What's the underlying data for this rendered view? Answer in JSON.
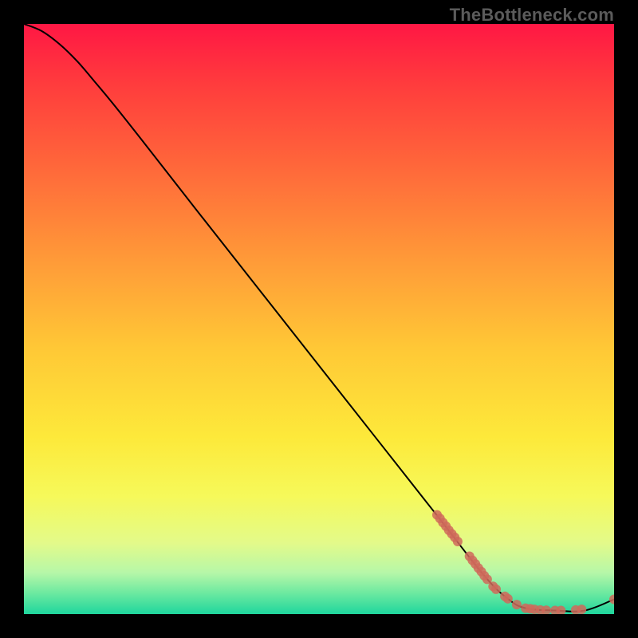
{
  "watermark": "TheBottleneck.com",
  "chart_data": {
    "type": "line",
    "title": "",
    "xlabel": "",
    "ylabel": "",
    "xlim": [
      0,
      100
    ],
    "ylim": [
      0,
      100
    ],
    "grid": false,
    "legend": false,
    "curve_color": "#000000",
    "marker_color": "#cf6a5b",
    "background_gradient": {
      "stops": [
        {
          "pos": 0.0,
          "color": "#ff1744"
        },
        {
          "pos": 0.1,
          "color": "#ff3b3d"
        },
        {
          "pos": 0.25,
          "color": "#ff6a3a"
        },
        {
          "pos": 0.4,
          "color": "#ff9a38"
        },
        {
          "pos": 0.55,
          "color": "#ffc836"
        },
        {
          "pos": 0.7,
          "color": "#fde93a"
        },
        {
          "pos": 0.8,
          "color": "#f6f95a"
        },
        {
          "pos": 0.88,
          "color": "#e3fa8a"
        },
        {
          "pos": 0.93,
          "color": "#b6f7a8"
        },
        {
          "pos": 0.965,
          "color": "#6be9a0"
        },
        {
          "pos": 1.0,
          "color": "#1fd69d"
        }
      ]
    },
    "curve": [
      {
        "x": 0.0,
        "y": 100.0
      },
      {
        "x": 3.0,
        "y": 98.8
      },
      {
        "x": 6.0,
        "y": 96.6
      },
      {
        "x": 9.0,
        "y": 93.7
      },
      {
        "x": 12.0,
        "y": 90.2
      },
      {
        "x": 15.0,
        "y": 86.6
      },
      {
        "x": 20.0,
        "y": 80.3
      },
      {
        "x": 30.0,
        "y": 67.5
      },
      {
        "x": 40.0,
        "y": 54.8
      },
      {
        "x": 50.0,
        "y": 42.1
      },
      {
        "x": 60.0,
        "y": 29.4
      },
      {
        "x": 70.0,
        "y": 16.7
      },
      {
        "x": 78.0,
        "y": 6.5
      },
      {
        "x": 82.0,
        "y": 2.6
      },
      {
        "x": 85.0,
        "y": 1.0
      },
      {
        "x": 90.0,
        "y": 0.6
      },
      {
        "x": 95.0,
        "y": 0.6
      },
      {
        "x": 100.0,
        "y": 2.5
      }
    ],
    "markers": [
      {
        "x": 70.0,
        "y": 16.8
      },
      {
        "x": 70.5,
        "y": 16.2
      },
      {
        "x": 71.0,
        "y": 15.5
      },
      {
        "x": 71.5,
        "y": 14.9
      },
      {
        "x": 72.0,
        "y": 14.2
      },
      {
        "x": 72.5,
        "y": 13.6
      },
      {
        "x": 73.0,
        "y": 13.0
      },
      {
        "x": 73.5,
        "y": 12.3
      },
      {
        "x": 75.5,
        "y": 9.8
      },
      {
        "x": 76.0,
        "y": 9.1
      },
      {
        "x": 76.5,
        "y": 8.5
      },
      {
        "x": 77.0,
        "y": 7.8
      },
      {
        "x": 77.5,
        "y": 7.2
      },
      {
        "x": 78.0,
        "y": 6.5
      },
      {
        "x": 78.5,
        "y": 5.9
      },
      {
        "x": 79.5,
        "y": 4.7
      },
      {
        "x": 80.0,
        "y": 4.2
      },
      {
        "x": 81.5,
        "y": 3.0
      },
      {
        "x": 82.0,
        "y": 2.6
      },
      {
        "x": 83.5,
        "y": 1.6
      },
      {
        "x": 85.0,
        "y": 1.0
      },
      {
        "x": 85.8,
        "y": 0.9
      },
      {
        "x": 86.5,
        "y": 0.8
      },
      {
        "x": 87.5,
        "y": 0.7
      },
      {
        "x": 88.5,
        "y": 0.65
      },
      {
        "x": 90.0,
        "y": 0.6
      },
      {
        "x": 91.0,
        "y": 0.6
      },
      {
        "x": 93.5,
        "y": 0.7
      },
      {
        "x": 94.5,
        "y": 0.8
      },
      {
        "x": 100.0,
        "y": 2.5
      }
    ]
  }
}
